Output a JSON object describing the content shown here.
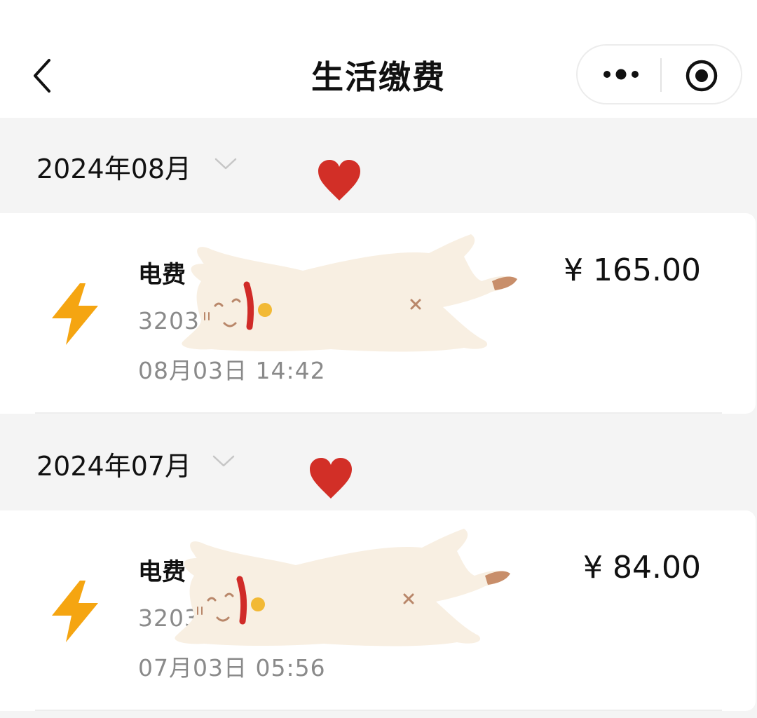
{
  "header": {
    "title": "生活缴费",
    "back_icon": "chevron-left-icon",
    "more_icon": "more-dots-icon",
    "close_icon": "target-circle-icon"
  },
  "colors": {
    "accent_bolt": "#f5a511",
    "heart": "#d22f27",
    "page_bg": "#f4f4f4"
  },
  "months": [
    {
      "label": "2024年08月",
      "bills": [
        {
          "name": "电费",
          "account": "3203",
          "time": "08月03日 14:42",
          "amount": "¥ 165.00",
          "icon": "lightning-bolt-icon"
        }
      ]
    },
    {
      "label": "2024年07月",
      "bills": [
        {
          "name": "电费",
          "account": "3203",
          "time": "07月03日 05:56",
          "amount": "¥ 84.00",
          "icon": "lightning-bolt-icon"
        }
      ]
    }
  ]
}
